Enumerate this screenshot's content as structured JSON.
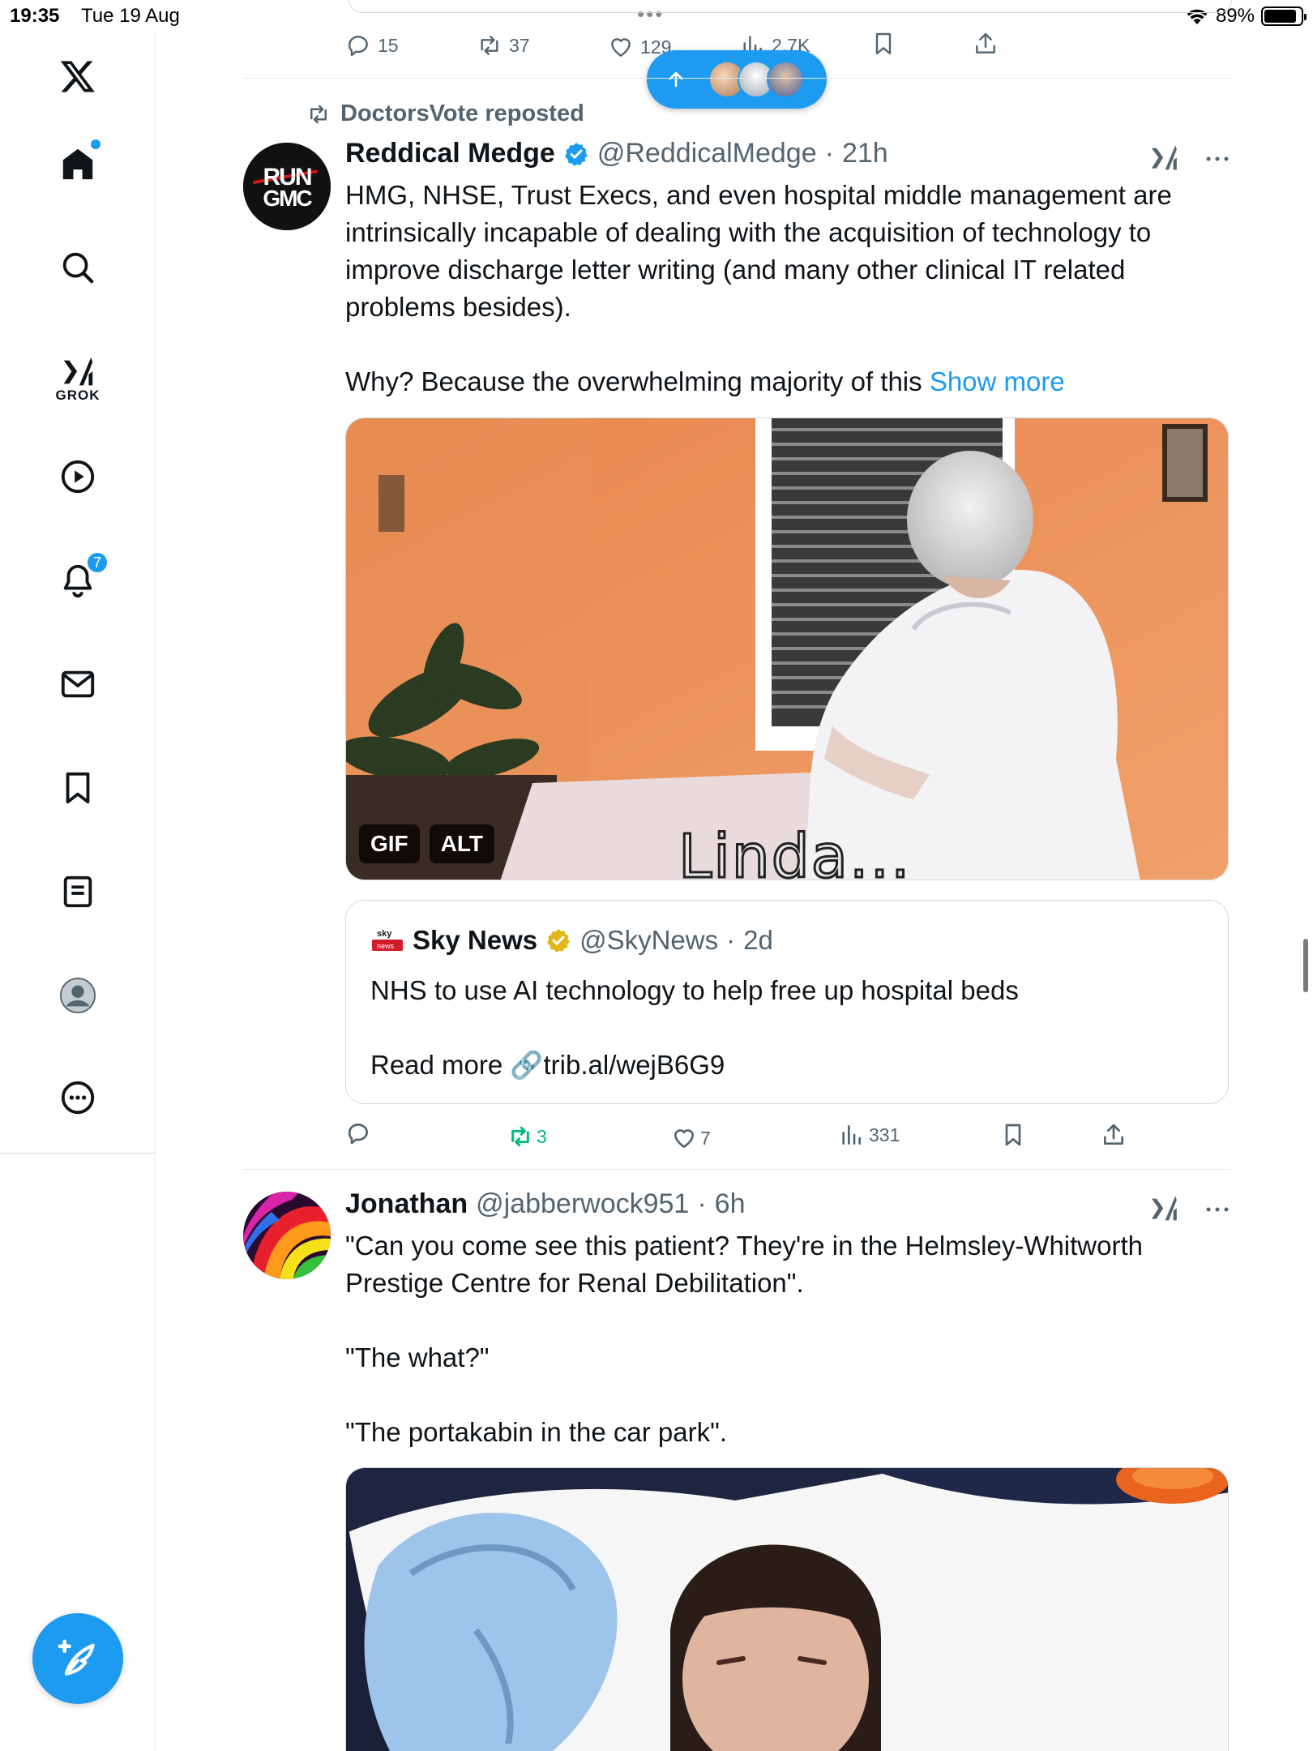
{
  "status_bar": {
    "time": "19:35",
    "date": "Tue 19 Aug",
    "battery": "89%",
    "battery_level": 0.89,
    "icons": [
      "wifi-icon",
      "battery-icon"
    ]
  },
  "sidebar": {
    "items": [
      {
        "name": "x-logo",
        "icon": "x-logo-icon"
      },
      {
        "name": "home",
        "icon": "home-icon",
        "has_dot": true
      },
      {
        "name": "explore",
        "icon": "search-icon"
      },
      {
        "name": "grok",
        "icon": "grok-icon",
        "label": "GROK"
      },
      {
        "name": "videos",
        "icon": "play-icon"
      },
      {
        "name": "notifications",
        "icon": "bell-icon",
        "badge": "7"
      },
      {
        "name": "messages",
        "icon": "envelope-icon"
      },
      {
        "name": "bookmarks",
        "icon": "bookmark-icon"
      },
      {
        "name": "lists",
        "icon": "list-icon"
      },
      {
        "name": "profile",
        "icon": "profile-avatar-icon"
      },
      {
        "name": "more",
        "icon": "more-circle-icon"
      }
    ],
    "compose_icon": "compose-feather-icon"
  },
  "prev_tweet_actions": {
    "replies": "15",
    "reposts": "37",
    "likes": "129",
    "views": "2.7K"
  },
  "new_posts_pill": {
    "icon": "arrow-up-icon",
    "avatars": 3
  },
  "tweet1": {
    "repost_label": "DoctorsVote reposted",
    "avatar_text": "RUN GMC",
    "name": "Reddical Medge",
    "handle": "@ReddicalMedge",
    "sep": "·",
    "time": "21h",
    "text": "HMG, NHSE, Trust Execs, and even hospital middle management are intrinsically incapable of dealing with the acquisition of technology to improve discharge letter writing (and many other clinical IT related problems besides).\n\nWhy? Because the overwhelming majority of this ",
    "show_more": "Show more",
    "media": {
      "badge_gif": "GIF",
      "badge_alt": "ALT",
      "caption": "Linda..."
    },
    "quote": {
      "logo_text": "sky news",
      "name": "Sky News",
      "handle": "@SkyNews",
      "sep": "·",
      "time": "2d",
      "text": "NHS to use AI technology to help free up hospital beds\n\nRead more 🔗trib.al/wejB6G9"
    },
    "actions": {
      "replies": "",
      "reposts": "3",
      "likes": "7",
      "views": "331"
    }
  },
  "tweet2": {
    "name": "Jonathan",
    "handle": "@jabberwock951",
    "sep": "·",
    "time": "6h",
    "text": "\"Can you come see this patient? They're in the Helmsley-Whitworth Prestige Centre for Renal Debilitation\".\n\n\"The what?\"\n\n\"The portakabin in the car park\"."
  },
  "colors": {
    "accent": "#1d9bf0",
    "repost_green": "#00ba7c",
    "text": "#0f1419",
    "muted": "#536471",
    "gold_verified": "#e2b719"
  }
}
